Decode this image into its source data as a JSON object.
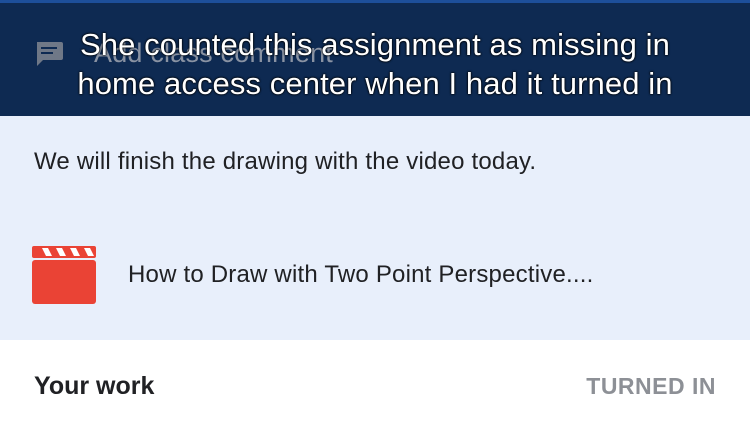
{
  "caption": {
    "line1": "She counted this assignment as missing in",
    "line2": "home access center when I had it turned in"
  },
  "comment": {
    "icon": "comment-icon",
    "placeholder": "Add class comment"
  },
  "assignment": {
    "instructions": "We will finish the drawing with the video today.",
    "attachment": {
      "icon": "video-clapperboard-icon",
      "title": "How to Draw with Two Point Perspective...."
    }
  },
  "your_work": {
    "label": "Your work",
    "status": "TURNED IN"
  },
  "colors": {
    "banner": "#0e2a52",
    "assignment_bg": "#e8effb",
    "video_icon": "#ea4335",
    "status_gray": "#8d9096"
  }
}
